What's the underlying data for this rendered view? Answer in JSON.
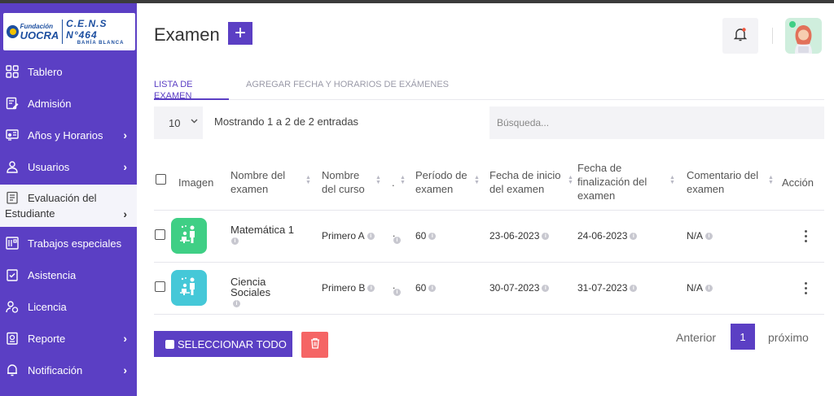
{
  "brand": {
    "fundacion": "Fundación",
    "uocra": "UOCRA",
    "cens": "C.E.N.S N°464",
    "city": "BAHÍA BLANCA"
  },
  "sidebar": {
    "items": [
      {
        "label": "Tablero",
        "icon": "dashboard-icon"
      },
      {
        "label": "Admisión",
        "icon": "admission-icon"
      },
      {
        "label": "Años y Horarios",
        "icon": "schedule-icon"
      },
      {
        "label": "Usuarios",
        "icon": "user-icon"
      },
      {
        "label": "Evaluación del Estudiante",
        "icon": "evaluation-icon"
      },
      {
        "label": "Trabajos especiales",
        "icon": "special-work-icon"
      },
      {
        "label": "Asistencia",
        "icon": "attendance-icon"
      },
      {
        "label": "Licencia",
        "icon": "license-icon"
      },
      {
        "label": "Reporte",
        "icon": "report-icon"
      },
      {
        "label": "Notificación",
        "icon": "notification-icon"
      }
    ]
  },
  "header": {
    "title": "Examen",
    "add_label": "+"
  },
  "tabs": [
    {
      "label": "LISTA DE EXAMEN",
      "active": true
    },
    {
      "label": "AGREGAR FECHA Y HORARIOS DE EXÁMENES",
      "active": false
    }
  ],
  "controls": {
    "page_size": "10",
    "showing": "Mostrando 1 a 2 de 2 entradas",
    "search_placeholder": "Búsqueda..."
  },
  "table": {
    "columns": [
      "Imagen",
      "Nombre del examen",
      "Nombre del curso",
      ".",
      "Período de examen",
      "Fecha de inicio del examen",
      "Fecha de finalización del examen",
      "Comentario del examen",
      "Acción"
    ],
    "rows": [
      {
        "name": "Matemática 1",
        "course": "Primero A",
        "dot": ".",
        "period": "60",
        "start": "23-06-2023",
        "end": "24-06-2023",
        "comment": "N/A",
        "image_color": "#3fcf85"
      },
      {
        "name": "Ciencia Sociales",
        "course": "Primero B",
        "dot": ".",
        "period": "60",
        "start": "30-07-2023",
        "end": "31-07-2023",
        "comment": "N/A",
        "image_color": "#45c8d8"
      }
    ]
  },
  "footer": {
    "select_all": "SELECCIONAR TODO",
    "prev": "Anterior",
    "page": "1",
    "next": "próximo"
  },
  "colors": {
    "accent": "#5b3fc4",
    "danger": "#f56565"
  }
}
